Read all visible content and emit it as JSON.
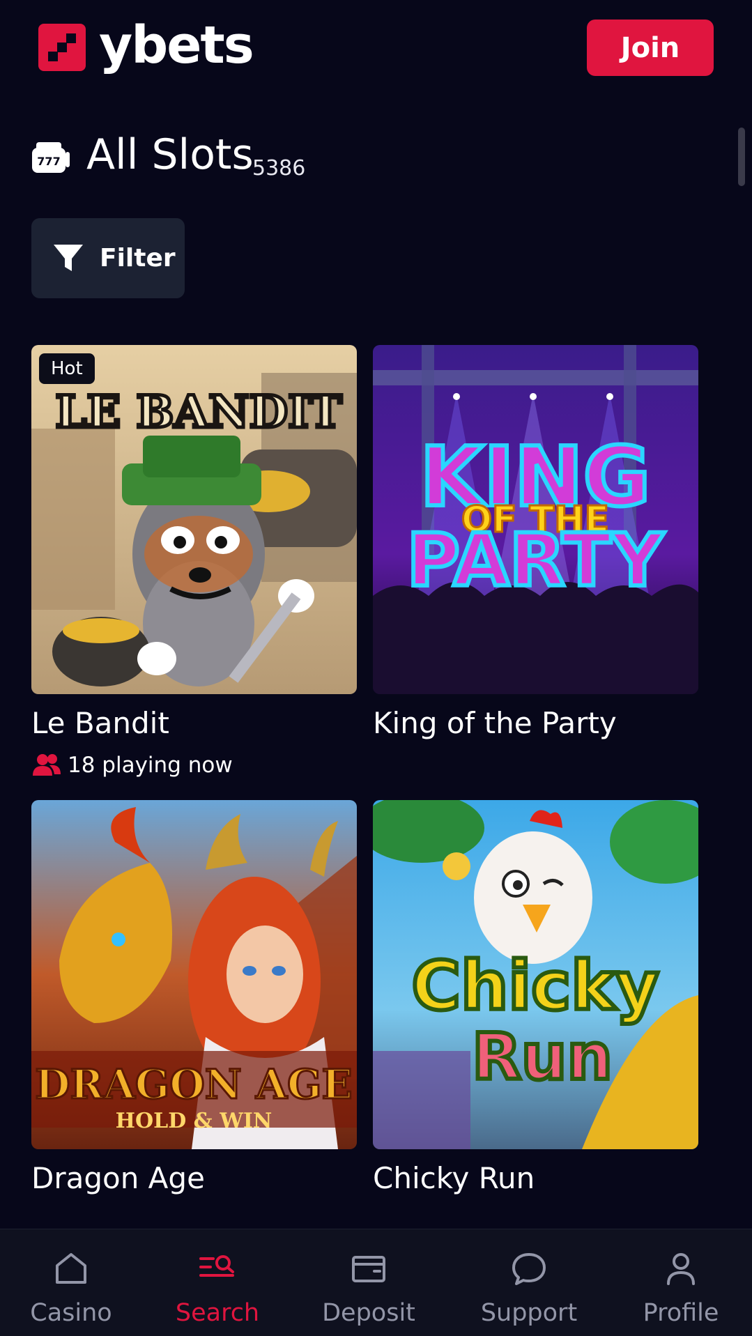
{
  "header": {
    "brand": "ybets",
    "join_label": "Join"
  },
  "section": {
    "title": "All Slots",
    "count": "5386",
    "icon": "slot-machine-icon"
  },
  "filter": {
    "label": "Filter",
    "icon": "funnel-icon"
  },
  "games": [
    {
      "name": "Le Bandit",
      "badge": "Hot",
      "players": "18 playing now",
      "art_title_1": "LE BANDIT"
    },
    {
      "name": "King of the Party",
      "art_title_1": "KING",
      "art_title_2": "OF THE",
      "art_title_3": "PARTY"
    },
    {
      "name": "Dragon Age",
      "art_title_1": "DRAGON AGE",
      "art_title_2": "HOLD & WIN"
    },
    {
      "name": "Chicky Run",
      "art_title_1": "Chicky",
      "art_title_2": "Run"
    }
  ],
  "nav": {
    "items": [
      {
        "label": "Casino",
        "icon": "house-icon"
      },
      {
        "label": "Search",
        "icon": "search-list-icon",
        "active": true
      },
      {
        "label": "Deposit",
        "icon": "wallet-icon"
      },
      {
        "label": "Support",
        "icon": "chat-bubble-icon"
      },
      {
        "label": "Profile",
        "icon": "user-icon"
      }
    ]
  },
  "colors": {
    "background": "#07071a",
    "accent": "#e0153f",
    "filter_bg": "#1c2233",
    "nav_bg": "#0f111f",
    "nav_inactive": "#9396a8"
  }
}
